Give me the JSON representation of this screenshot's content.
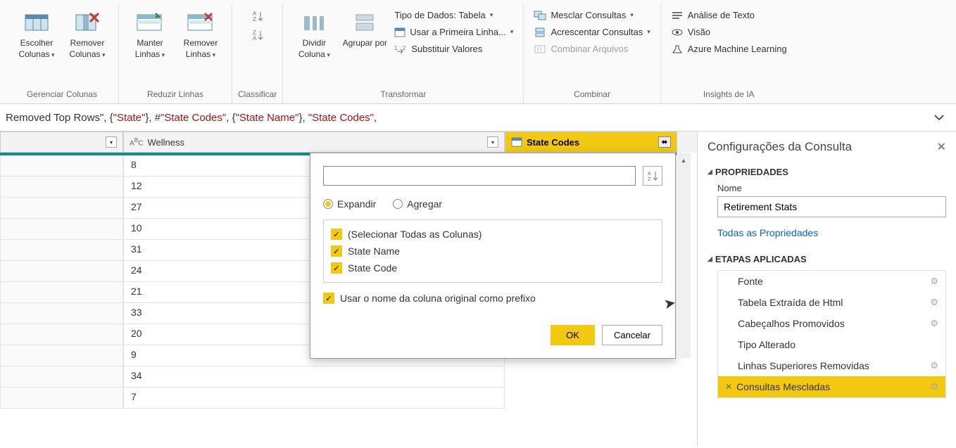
{
  "ribbon": {
    "groups": {
      "gerenciar": {
        "label": "Gerenciar Colunas",
        "choose": "Escolher Colunas",
        "remove": "Remover Colunas"
      },
      "reduzir": {
        "label": "Reduzir Linhas",
        "keep": "Manter Linhas",
        "remove": "Remover Linhas"
      },
      "classificar": {
        "label": "Classificar"
      },
      "transformar": {
        "label": "Transformar",
        "split": "Dividir Coluna",
        "group": "Agrupar por",
        "datatype": "Tipo de Dados: Tabela",
        "firstrow": "Usar a Primeira Linha...",
        "replace": "Substituir Valores"
      },
      "combinar": {
        "label": "Combinar",
        "merge": "Mesclar Consultas",
        "append": "Acrescentar Consultas",
        "combine": "Combinar Arquivos"
      },
      "insights": {
        "label": "Insights de IA",
        "text": "Análise de Texto",
        "vision": "Visão",
        "azure": "Azure Machine Learning"
      }
    }
  },
  "formula": {
    "t1": "Removed Top Rows\"",
    "t2": ", {",
    "s1": "\"State\"",
    "t3": "}, #",
    "s2": "\"State Codes\"",
    "t4": ", {",
    "s3": "\"State Name\"",
    "t5": "}, ",
    "s4": "\"State Codes\"",
    "t6": ","
  },
  "columns": {
    "wellness": "Wellness",
    "state": "State Codes"
  },
  "data_rows": [
    "8",
    "12",
    "27",
    "10",
    "31",
    "24",
    "21",
    "33",
    "20",
    "9",
    "34",
    "7"
  ],
  "popup": {
    "expand": "Expandir",
    "aggregate": "Agregar",
    "select_all": "(Selecionar Todas as Colunas)",
    "col1": "State Name",
    "col2": "State Code",
    "prefix": "Usar o nome da coluna original como prefixo",
    "ok": "OK",
    "cancel": "Cancelar"
  },
  "rpane": {
    "title": "Configurações da Consulta",
    "props": "PROPRIEDADES",
    "name_label": "Nome",
    "name_value": "Retirement Stats",
    "all_props": "Todas as Propriedades",
    "steps_title": "ETAPAS APLICADAS",
    "steps": [
      {
        "label": "Fonte",
        "gear": true
      },
      {
        "label": "Tabela Extraída de Html",
        "gear": true
      },
      {
        "label": "Cabeçalhos Promovidos",
        "gear": true
      },
      {
        "label": "Tipo Alterado",
        "gear": false
      },
      {
        "label": "Linhas Superiores Removidas",
        "gear": true
      },
      {
        "label": "Consultas Mescladas",
        "gear": true,
        "selected": true
      }
    ]
  }
}
